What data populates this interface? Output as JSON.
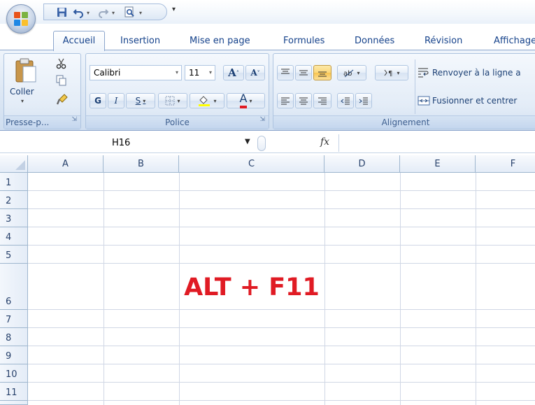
{
  "quick_access": {
    "items": [
      "save",
      "undo",
      "redo",
      "print-preview",
      "customize"
    ]
  },
  "tabs": [
    {
      "label": "Accueil",
      "active": true
    },
    {
      "label": "Insertion"
    },
    {
      "label": "Mise en page"
    },
    {
      "label": "Formules"
    },
    {
      "label": "Données"
    },
    {
      "label": "Révision"
    },
    {
      "label": "Affichage"
    }
  ],
  "ribbon": {
    "clipboard": {
      "paste_label": "Coller",
      "group_label": "Presse-p..."
    },
    "font": {
      "font_name": "Calibri",
      "font_size": "11",
      "bold": "G",
      "italic": "I",
      "underline": "S",
      "grow_font": "A",
      "shrink_font": "A",
      "font_color": "A",
      "group_label": "Police"
    },
    "alignment": {
      "wrap_text": "Renvoyer à la ligne a",
      "merge_center": "Fusionner et centrer",
      "group_label": "Alignement"
    }
  },
  "formula_bar": {
    "name_box": "H16",
    "fx_label": "fx",
    "value": ""
  },
  "sheet": {
    "columns": [
      "A",
      "B",
      "C",
      "D",
      "E",
      "F"
    ],
    "rows": [
      "1",
      "2",
      "3",
      "4",
      "5",
      "6",
      "7",
      "8",
      "9",
      "10",
      "11"
    ],
    "cells": {
      "C6": "ALT + F11"
    },
    "cell_c6_color": "#e01b24"
  },
  "colors": {
    "ribbon_bg": "#dfe9f5",
    "tab_text": "#15428b",
    "header_bg": "#e4ecf7"
  }
}
